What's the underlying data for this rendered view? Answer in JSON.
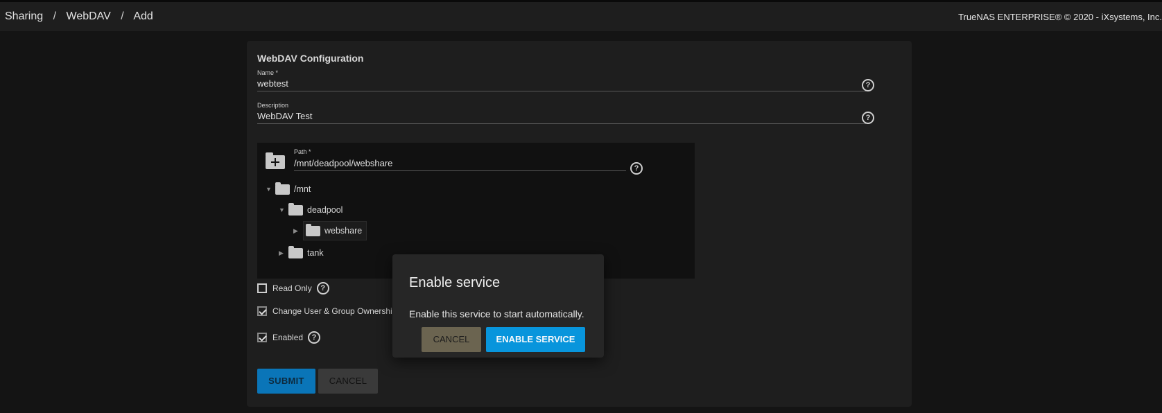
{
  "breadcrumb": [
    "Sharing",
    "WebDAV",
    "Add"
  ],
  "breadcrumb_sep": "/",
  "copyright": "TrueNAS ENTERPRISE® © 2020 - iXsystems, Inc.",
  "form": {
    "title": "WebDAV Configuration",
    "name": {
      "label": "Name *",
      "value": "webtest"
    },
    "description": {
      "label": "Description",
      "value": "WebDAV Test"
    },
    "path": {
      "label": "Path *",
      "value": "/mnt/deadpool/webshare"
    },
    "tree": [
      "/mnt",
      "deadpool",
      "webshare",
      "tank"
    ],
    "read_only": {
      "label": "Read Only",
      "checked": false
    },
    "change_ownership": {
      "label": "Change User & Group Ownership",
      "checked": true
    },
    "enabled": {
      "label": "Enabled",
      "checked": true
    },
    "submit_label": "SUBMIT",
    "cancel_label": "CANCEL",
    "help_glyph": "?"
  },
  "dialog": {
    "title": "Enable service",
    "message": "Enable this service to start automatically.",
    "cancel_label": "CANCEL",
    "confirm_label": "ENABLE SERVICE"
  },
  "icons": {
    "help": "help-circle-icon",
    "folder": "folder-icon",
    "add_folder": "folder-plus-icon",
    "expand": "triangle-icon"
  },
  "colors": {
    "primary": "#0895dc",
    "submit": "#0a75b8",
    "background": "#141414",
    "card": "#1e1e1e"
  }
}
